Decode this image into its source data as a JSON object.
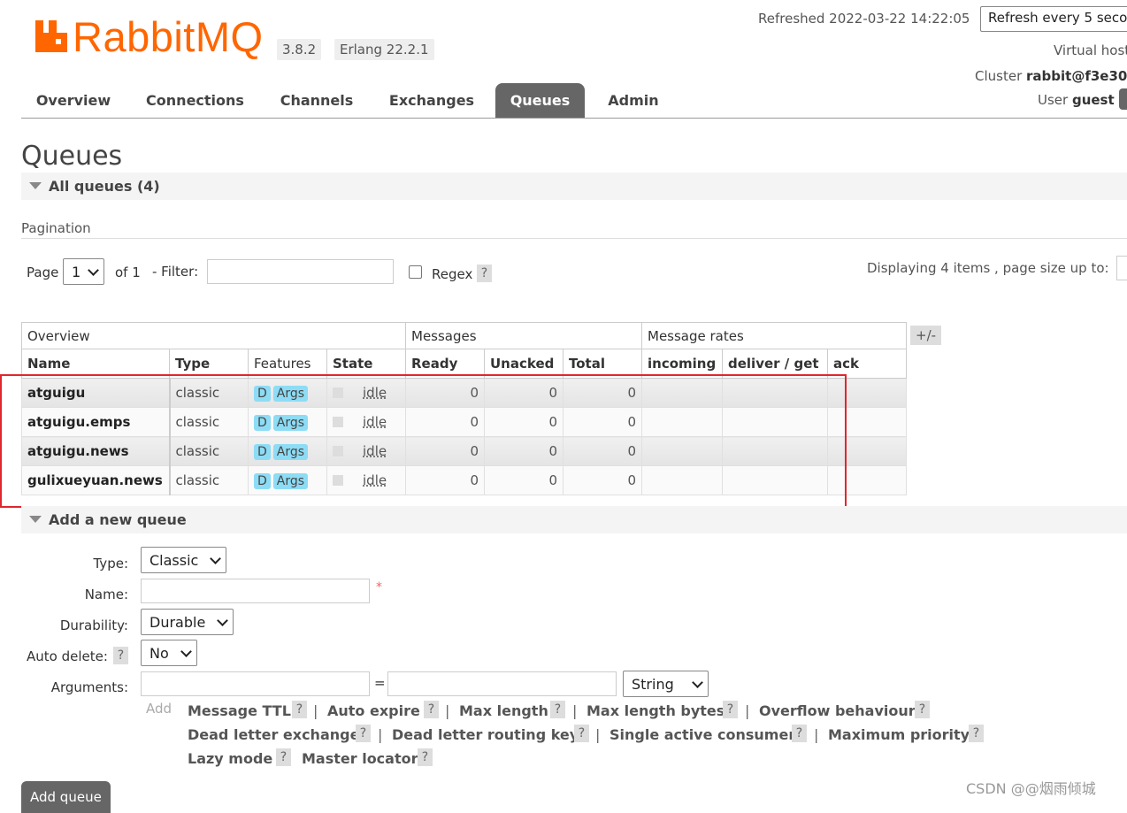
{
  "header": {
    "logo_text": "RabbitMQ",
    "version": "3.8.2",
    "erlang": "Erlang 22.2.1",
    "refreshed": "Refreshed 2022-03-22 14:22:05",
    "refresh_select": "Refresh every 5 seco",
    "virtual_host": "Virtual host",
    "cluster_label": "Cluster ",
    "cluster_value": "rabbit@f3e30",
    "user_label": "User ",
    "user_value": "guest"
  },
  "tabs": [
    "Overview",
    "Connections",
    "Channels",
    "Exchanges",
    "Queues",
    "Admin"
  ],
  "page_title": "Queues",
  "all_queues": "All queues (4)",
  "pagination": {
    "title": "Pagination",
    "page_label": "Page",
    "page_value": "1",
    "of_label": "of 1",
    "filter_label": "- Filter:",
    "regex_label": "Regex",
    "help": "?",
    "displaying": "Displaying 4 items , page size up to:"
  },
  "table": {
    "groups": [
      "Overview",
      "Messages",
      "Message rates"
    ],
    "plus_minus": "+/-",
    "columns": [
      "Name",
      "Type",
      "Features",
      "State",
      "Ready",
      "Unacked",
      "Total",
      "incoming",
      "deliver / get",
      "ack"
    ],
    "rows": [
      {
        "name": "atguigu",
        "type": "classic",
        "f1": "D",
        "f2": "Args",
        "state": "idle",
        "ready": "0",
        "unacked": "0",
        "total": "0"
      },
      {
        "name": "atguigu.emps",
        "type": "classic",
        "f1": "D",
        "f2": "Args",
        "state": "idle",
        "ready": "0",
        "unacked": "0",
        "total": "0"
      },
      {
        "name": "atguigu.news",
        "type": "classic",
        "f1": "D",
        "f2": "Args",
        "state": "idle",
        "ready": "0",
        "unacked": "0",
        "total": "0"
      },
      {
        "name": "gulixueyuan.news",
        "type": "classic",
        "f1": "D",
        "f2": "Args",
        "state": "idle",
        "ready": "0",
        "unacked": "0",
        "total": "0"
      }
    ]
  },
  "add_queue": {
    "title": "Add a new queue",
    "type_label": "Type:",
    "type_value": "Classic",
    "name_label": "Name:",
    "required_mark": "*",
    "durability_label": "Durability:",
    "durability_value": "Durable",
    "auto_delete_label": "Auto delete:",
    "auto_delete_value": "No",
    "arguments_label": "Arguments:",
    "equals": "=",
    "arg_type_value": "String",
    "add_label": "Add",
    "arg_links": [
      "Message TTL",
      "Auto expire",
      "Max length",
      "Max length bytes",
      "Overflow behaviour",
      "Dead letter exchange",
      "Dead letter routing key",
      "Single active consumer",
      "Maximum priority",
      "Lazy mode",
      "Master locator"
    ],
    "pipe": "|",
    "button": "Add queue"
  },
  "watermark": "CSDN @@烟雨倾城",
  "colors": {
    "brand": "#ff6600",
    "tab_active": "#666666",
    "badge": "#8ddcf5",
    "highlight_box": "#e0262e"
  }
}
